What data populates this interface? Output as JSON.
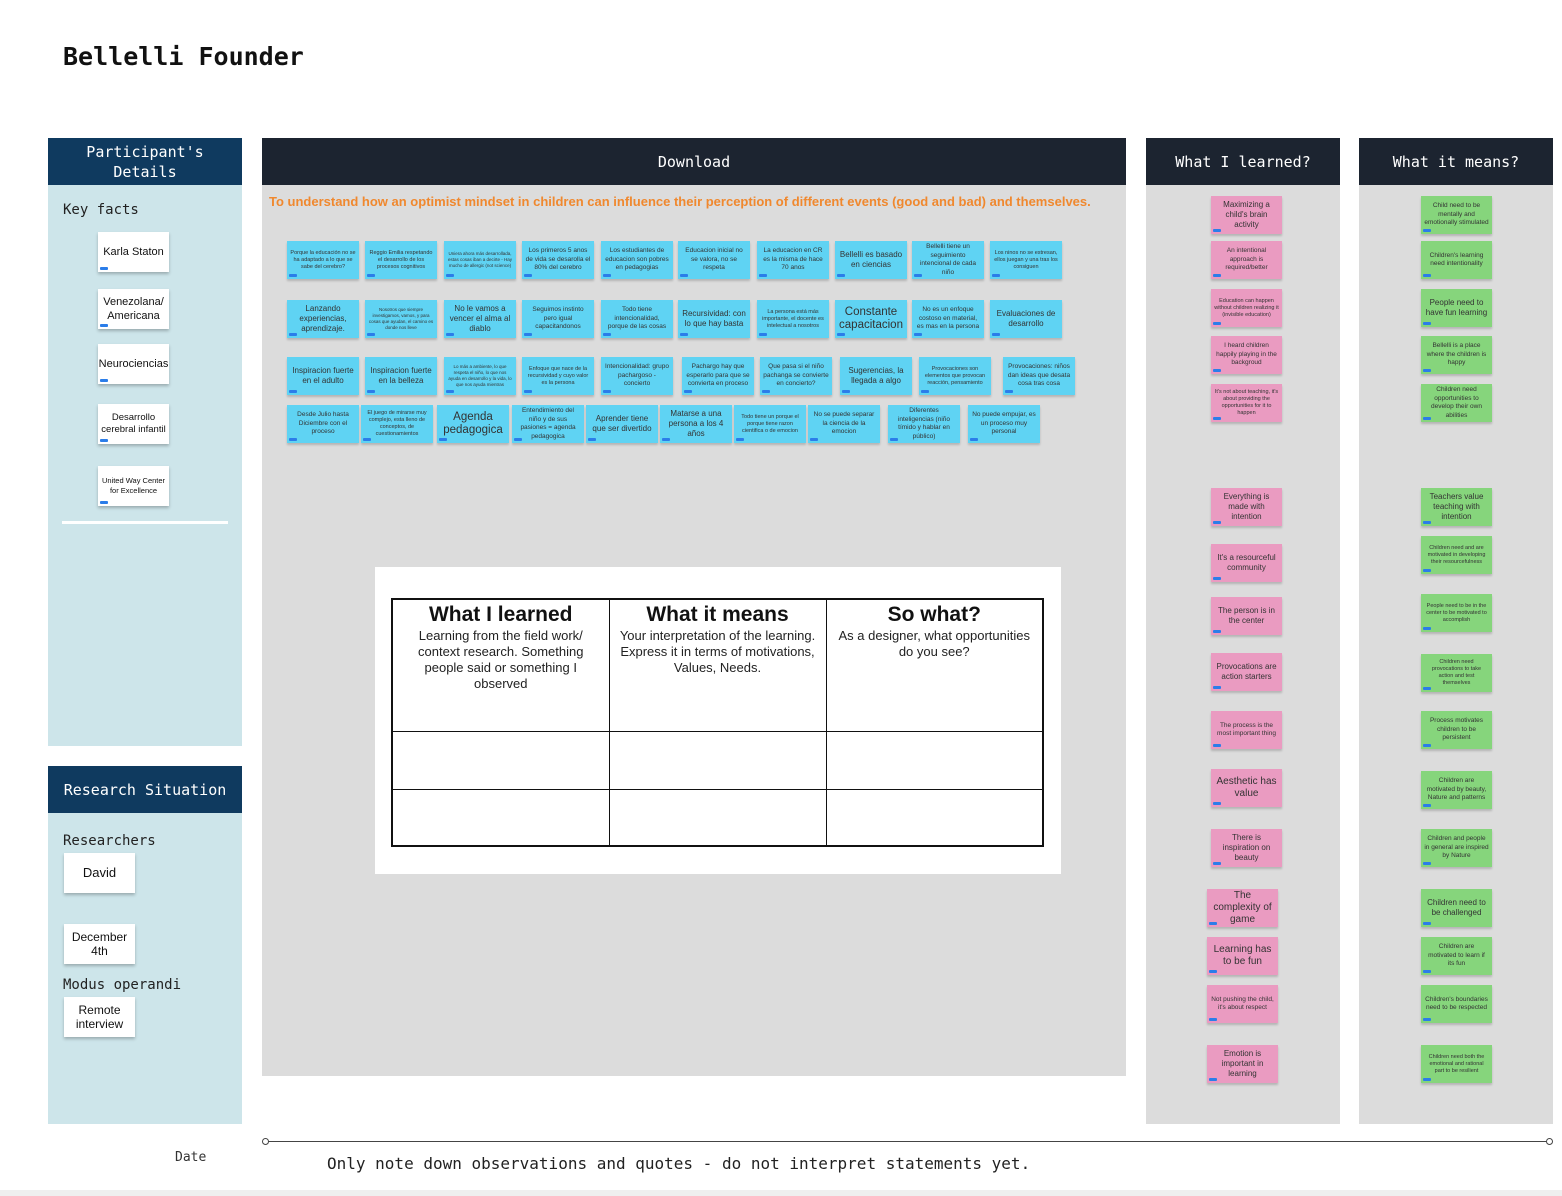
{
  "board": {
    "title": "Bellelli Founder"
  },
  "participant": {
    "header": "Participant's Details",
    "key_facts_label": "Key facts",
    "facts": [
      "Karla Staton",
      "Venezolana/ Americana",
      "Neurociencias",
      "Desarrollo cerebral infantil",
      "United Way Center for Excellence"
    ]
  },
  "research": {
    "header": "Research Situation",
    "researchers_label": "Researchers",
    "researcher": "David",
    "date": "December 4th",
    "modus_label": "Modus operandi",
    "modus": "Remote interview"
  },
  "download": {
    "header": "Download",
    "goal": "To understand how an optimist mindset in children can influence their perception of different events (good and bad) and themselves.",
    "notes": [
      "Porque la educación no se ha adaptado a lo que se sabe del cerebro?",
      "Reggio Emilia respetando el desarrollo de los procesos cognitivos",
      "Uniera ahora más desarrollada, estas cosas iban a decirte - Hay mucho de allergic (not science)",
      "Los primeros 5 anos de vida se desarolla el 80% del cerebro",
      "Los estudiantes de educacion son pobres en pedagogias",
      "Educacion inicial no se valora, no se respeta",
      "La educacion en CR es la misma de hace 70 anos",
      "Bellelli es basado en ciencias",
      "Bellelli tiene un seguimiento intencional de cada niño",
      "Los ninos no se estresan, ellos juegan y una tras los consiguen",
      "Lanzando experiencias, aprendizaje.",
      "Nosotros que siempre investigamos, vamos, y para cosas que ayudan, el camino es donde nos lleve",
      "No le vamos a vencer el alma al diablo",
      "Seguimos instinto pero igual capacitandonos",
      "Todo tiene intencionalidad, porque de las cosas",
      "Recursividad: con lo que hay basta",
      "La persona está más importante, el docente es intelectual a nosotros",
      "Constante capacitacion",
      "No es un enfoque costoso en material, es mas en la persona",
      "Evaluaciones de desarrollo",
      "Inspiracion fuerte en el adulto",
      "Inspiracion fuerte en la belleza",
      "Lo más a ambiente, lo que respeta el niño, lo que nos ayuda en desarrollo y la vida, lo que nos ayuda mientras",
      "Enfoque que nace de la recursividad y cuyo valor es la persona",
      "Intencionalidad: grupo pachargoso - concierto",
      "Pachargo hay que esperarlo para que se convierta en proceso",
      "Que pasa si el niño pachanga se convierte en concierto?",
      "Sugerencias, la llegada a algo",
      "Provocaciones son elementos que provocan reacción, pensamiento",
      "Provocaciones: niños dan ideas que desata cosa tras cosa",
      "Desde Julio hasta Diciembre con el proceso",
      "El juego de mirarse muy complejo, esta lleno de conceptos, de cuestionamientos",
      "Agenda pedagogica",
      "Entendimiento del niño y de sus pasiones = agenda pedagogica",
      "Aprender tiene que ser divertido",
      "Matarse a una persona a los 4 años",
      "Todo tiene un porque el porque tiene razon cientifica o de emocion",
      "No se puede separar la ciencia de la emocion",
      "Diferentes inteligencias (niño tímido y hablar en público)",
      "No puede empujar, es un proceso muy personal"
    ]
  },
  "framework": {
    "columns": [
      {
        "title": "What I learned",
        "desc": "Learning from the field work/ context research. Something people said or something I observed"
      },
      {
        "title": "What it means",
        "desc": "Your interpretation of the learning. Express it in terms of motivations, Values, Needs."
      },
      {
        "title": "So what?",
        "desc": "As a designer, what opportunities do you see?"
      }
    ]
  },
  "learned": {
    "header": "What I learned?",
    "notes": [
      "Maximizing a child's brain activity",
      "An intentional approach is required/better",
      "Education can happen without children realizing it (invisible education)",
      "I heard children happily playing in the backgroud",
      "It's not about teaching, it's about providing the opportunities for it to happen",
      "Everything is made with intention",
      "It's a resourceful community",
      "The person is in the center",
      "Provocations are action starters",
      "The process is the most important thing",
      "Aesthetic has value",
      "There is inspiration on beauty",
      "The complexity of game",
      "Learning has to be fun",
      "Not pushing the child, it's about respect",
      "Emotion is important in learning"
    ]
  },
  "means": {
    "header": "What it means?",
    "notes": [
      "Child need to be mentally and emotionally stimulated",
      "Children's learning need intentionality",
      "People need to have fun learning",
      "Bellelli is a place where the children is happy",
      "Children need opportunities to develop their own abilities",
      "Teachers value teaching with intention",
      "Children need and are motivated in developing their resourcefulness",
      "People need to be in the center to be motivated to accomplish",
      "Children need provocations to take action and test themselves",
      "Process motivates children to be persistent",
      "Children are motivated by beauty, Nature and patterns",
      "Children and people in general are inspired by Nature",
      "Children need to be challenged",
      "Children are motivated to learn if its fun",
      "Children's boundaries need to be respected",
      "Children need both the emotional and rational part to be resilient"
    ]
  },
  "footer": {
    "date_label": "Date",
    "note": "Only note down observations and quotes - do not interpret statements yet."
  },
  "colors": {
    "navy_header": "#0f3a5f",
    "dark_header": "#1c2430",
    "light_panel": "#cde5ea",
    "grey_panel": "#dcdcdc",
    "cyan_note": "#5fd3f3",
    "pink_note": "#ea9bc1",
    "green_note": "#86d57c",
    "goal_text": "#f0882e"
  }
}
